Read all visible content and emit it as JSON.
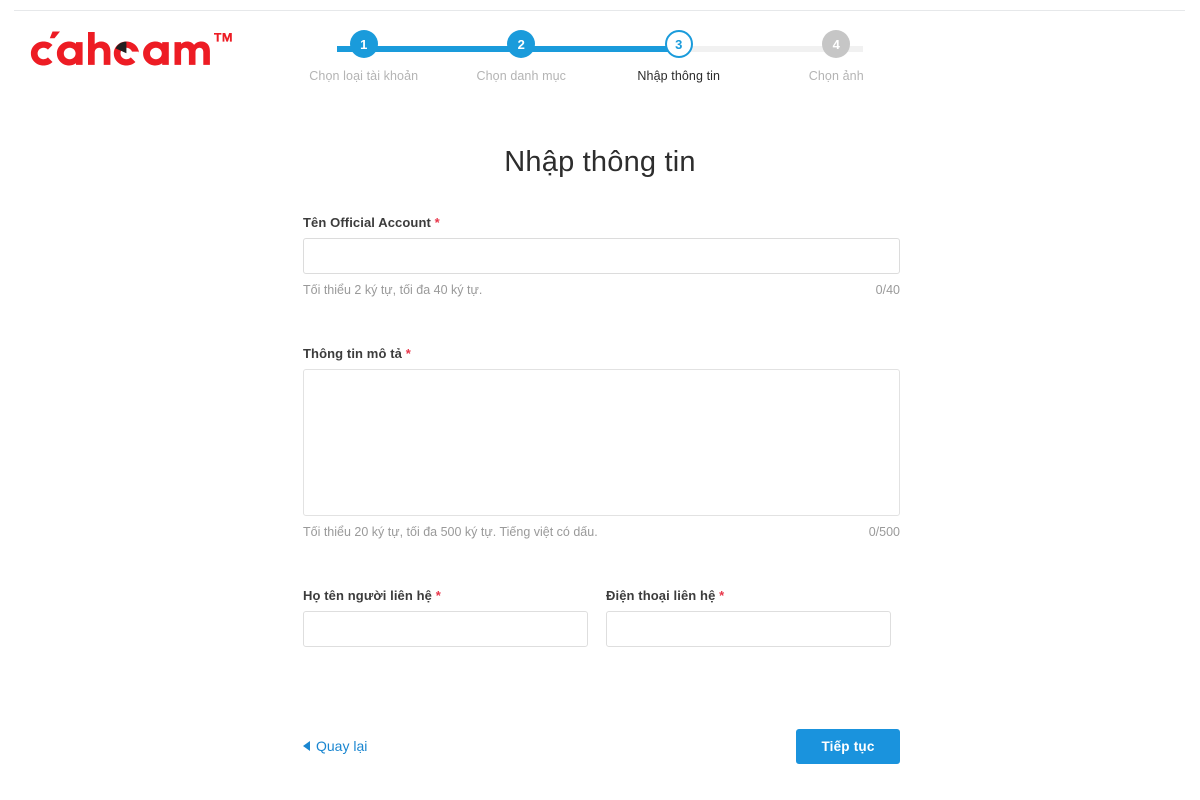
{
  "brand": {
    "logo_text": "cánhcam",
    "logo_trademark": "™",
    "logo_color": "#ed1c24",
    "logo_accent_color": "#231f20"
  },
  "theme": {
    "accent_blue": "#1a9bdb",
    "button_blue": "#1a93dd",
    "link_blue": "#1a86d0",
    "required_red": "#e8364a",
    "inactive_gray": "#c6c6c6",
    "track_gray": "#f1f1f1"
  },
  "stepper": {
    "current_step": 3,
    "steps": [
      {
        "number": "1",
        "label": "Chọn loại tài khoản",
        "state": "done"
      },
      {
        "number": "2",
        "label": "Chọn danh mục",
        "state": "done"
      },
      {
        "number": "3",
        "label": "Nhập thông tin",
        "state": "active"
      },
      {
        "number": "4",
        "label": "Chọn ảnh",
        "state": "todo"
      }
    ]
  },
  "page": {
    "title": "Nhập thông tin"
  },
  "form": {
    "account_name": {
      "label": "Tên Official Account",
      "required_mark": "*",
      "value": "",
      "placeholder": "",
      "hint": "Tối thiểu 2 ký tự, tối đa 40 ký tự.",
      "counter": "0/40"
    },
    "description": {
      "label": "Thông tin mô tả",
      "required_mark": "*",
      "value": "",
      "placeholder": "",
      "hint": "Tối thiểu 20 ký tự, tối đa 500 ký tự. Tiếng việt có dấu.",
      "counter": "0/500"
    },
    "contact_name": {
      "label": "Họ tên người liên hệ",
      "required_mark": "*",
      "value": "",
      "placeholder": ""
    },
    "contact_phone": {
      "label": "Điện thoại liên hệ",
      "required_mark": "*",
      "value": "",
      "placeholder": ""
    }
  },
  "footer": {
    "back_label": "Quay lại",
    "next_label": "Tiếp tục"
  }
}
